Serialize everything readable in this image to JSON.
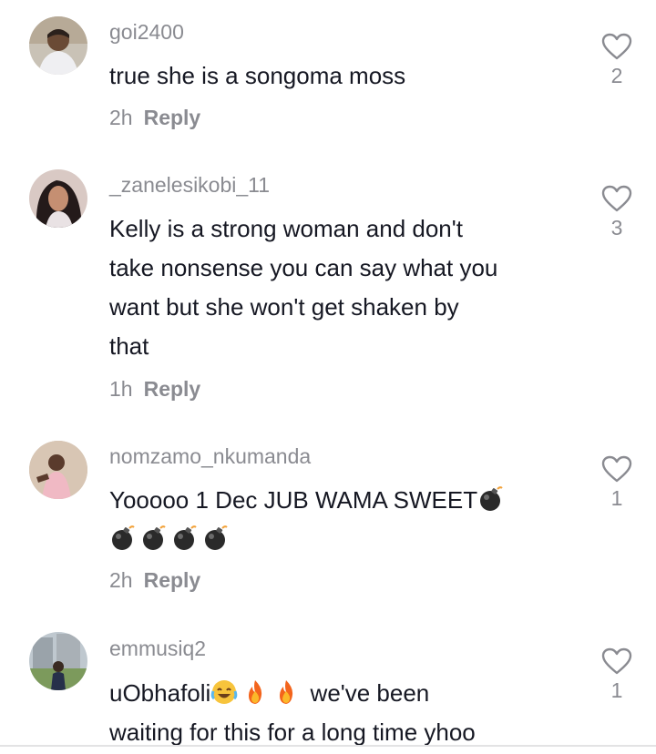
{
  "comments": [
    {
      "username": "goi2400",
      "lines": [
        "true she is a songoma moss"
      ],
      "time": "2h",
      "reply_label": "Reply",
      "likes": "2"
    },
    {
      "username": "_zanelesikobi_11",
      "lines": [
        "Kelly is a strong woman and don't",
        "take nonsense you can say what you",
        "want but she won't get shaken by",
        "that"
      ],
      "time": "1h",
      "reply_label": "Reply",
      "likes": "3"
    },
    {
      "username": "nomzamo_nkumanda",
      "lines": [
        "Yooooo 1 Dec JUB WAMA SWEET"
      ],
      "emojis": [
        "bomb-emoji",
        "bomb-emoji",
        "bomb-emoji",
        "bomb-emoji",
        "bomb-emoji"
      ],
      "time": "2h",
      "reply_label": "Reply",
      "likes": "1"
    },
    {
      "username": "emmusiq2",
      "text_a": "uObhafoli",
      "emojis": [
        "laughing-emoji",
        "fire-emoji",
        "fire-emoji"
      ],
      "text_b": " we've been",
      "line2": "waiting for this for a long time yhoo",
      "likes": "1"
    }
  ],
  "colors": {
    "text": "#161823",
    "secondary": "#8a8b91",
    "heart_stroke": "#8a8b91"
  }
}
